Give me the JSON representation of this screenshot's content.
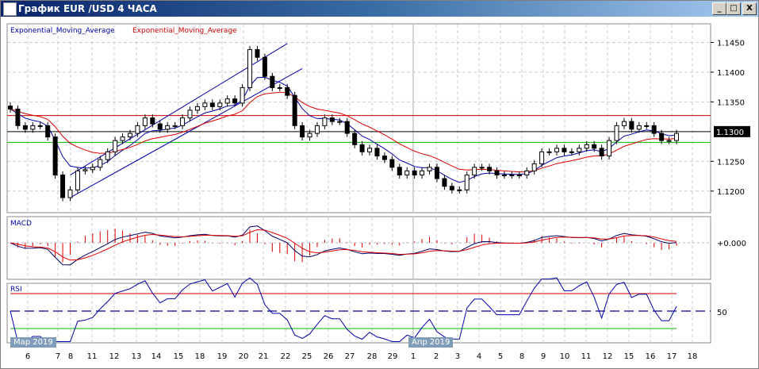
{
  "window": {
    "title": "График EUR /USD  4 ЧАСА",
    "minimize": "_",
    "maximize": "□",
    "close": "X"
  },
  "legend": {
    "ema_blue": "Exponential_Moving_Average",
    "ema_red": "Exponential_Moving_Average"
  },
  "panels": {
    "macd_label": "MACD",
    "macd_zero": "+0.000",
    "rsi_label": "RSI",
    "rsi_mid": "50"
  },
  "months": [
    "Мар 2019",
    "Апр 2019"
  ],
  "colors": {
    "ema_fast": "#0000aa",
    "ema_slow": "#dd0000",
    "resistance": "#cc0000",
    "support": "#00bb00",
    "channel": "#0000aa"
  },
  "chart_data": {
    "type": "candlestick",
    "symbol": "EUR/USD",
    "timeframe": "4H",
    "yticks": [
      "1.1450",
      "1.1400",
      "1.1350",
      "1.1250",
      "1.1200"
    ],
    "current_price": "1.1300",
    "ylim": [
      1.1165,
      1.148
    ],
    "xlabels": [
      "6",
      "7",
      "8",
      "11",
      "12",
      "13",
      "14",
      "15",
      "18",
      "19",
      "20",
      "21",
      "22",
      "25",
      "26",
      "27",
      "28",
      "29",
      "1",
      "2",
      "3",
      "4",
      "5",
      "8",
      "9",
      "10",
      "11",
      "12",
      "15",
      "16",
      "17",
      "18"
    ],
    "closes": [
      1.1338,
      1.131,
      1.1304,
      1.131,
      1.131,
      1.1291,
      1.1227,
      1.1189,
      1.1202,
      1.1234,
      1.1236,
      1.124,
      1.1253,
      1.1266,
      1.1285,
      1.1291,
      1.1297,
      1.131,
      1.1323,
      1.1313,
      1.1304,
      1.131,
      1.131,
      1.1323,
      1.1336,
      1.1342,
      1.1348,
      1.1342,
      1.1348,
      1.1355,
      1.1348,
      1.1374,
      1.1438,
      1.1425,
      1.1393,
      1.1374,
      1.1374,
      1.1361,
      1.131,
      1.1291,
      1.1297,
      1.131,
      1.1323,
      1.1317,
      1.1317,
      1.1297,
      1.1278,
      1.1266,
      1.1272,
      1.1259,
      1.1253,
      1.124,
      1.1227,
      1.1234,
      1.1227,
      1.1234,
      1.124,
      1.1221,
      1.1208,
      1.1202,
      1.1202,
      1.1227,
      1.124,
      1.124,
      1.1234,
      1.1227,
      1.1227,
      1.1227,
      1.1227,
      1.1234,
      1.1246,
      1.1266,
      1.1266,
      1.1272,
      1.1266,
      1.1266,
      1.1272,
      1.1278,
      1.1272,
      1.1259,
      1.1285,
      1.131,
      1.1317,
      1.1304,
      1.131,
      1.131,
      1.1297,
      1.1285,
      1.1285,
      1.1297
    ],
    "hlines": {
      "resistance": 1.1327,
      "current": 1.13,
      "support": 1.1282
    },
    "channel": [
      {
        "i0": 8,
        "p0": 1.1227,
        "i1": 37,
        "p1": 1.1448
      },
      {
        "i0": 8,
        "p0": 1.1189,
        "i1": 39,
        "p1": 1.1406
      }
    ],
    "rsi_levels": [
      70,
      50,
      30
    ]
  }
}
